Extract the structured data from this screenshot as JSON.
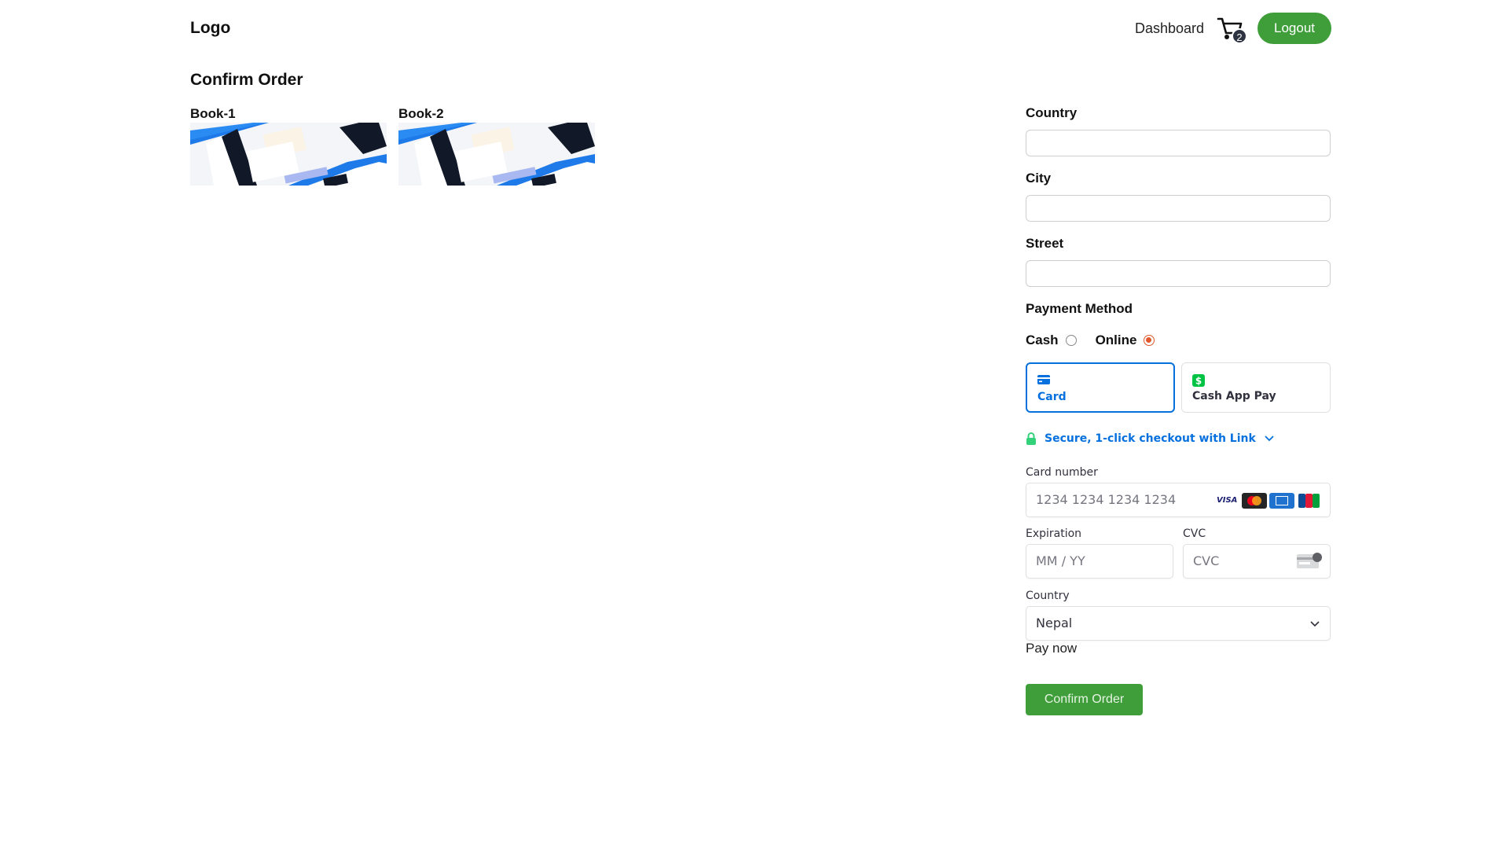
{
  "header": {
    "logo": "Logo",
    "nav_dashboard": "Dashboard",
    "cart_count": "2",
    "logout_label": "Logout",
    "logout_color": "#3f9e3a"
  },
  "main": {
    "title": "Confirm Order",
    "books": [
      {
        "title": "Book-1"
      },
      {
        "title": "Book-2"
      }
    ]
  },
  "form": {
    "country_label": "Country",
    "city_label": "City",
    "street_label": "Street",
    "payment_method_label": "Payment Method",
    "options": [
      "Cash",
      "Online"
    ],
    "selected_option": "Online",
    "stripe": {
      "tabs": [
        {
          "label": "Card",
          "icon": "card-icon",
          "selected": true
        },
        {
          "label": "Cash App Pay",
          "icon": "cash-app-icon",
          "selected": false
        }
      ],
      "link_text": "Secure, 1-click checkout with Link",
      "card_number_label": "Card number",
      "card_number_placeholder": "1234 1234 1234 1234",
      "expiration_label": "Expiration",
      "expiration_placeholder": "MM / YY",
      "cvc_label": "CVC",
      "cvc_placeholder": "CVC",
      "country_label": "Country",
      "country_value": "Nepal",
      "brand_icons": [
        "visa-icon",
        "mastercard-icon",
        "amex-icon",
        "jcb-icon"
      ],
      "brand_visa_text": "VISA",
      "accent_color": "#0570de"
    },
    "pay_now": "Pay now",
    "confirm_label": "Confirm Order",
    "confirm_color": "#3f9e3a"
  }
}
